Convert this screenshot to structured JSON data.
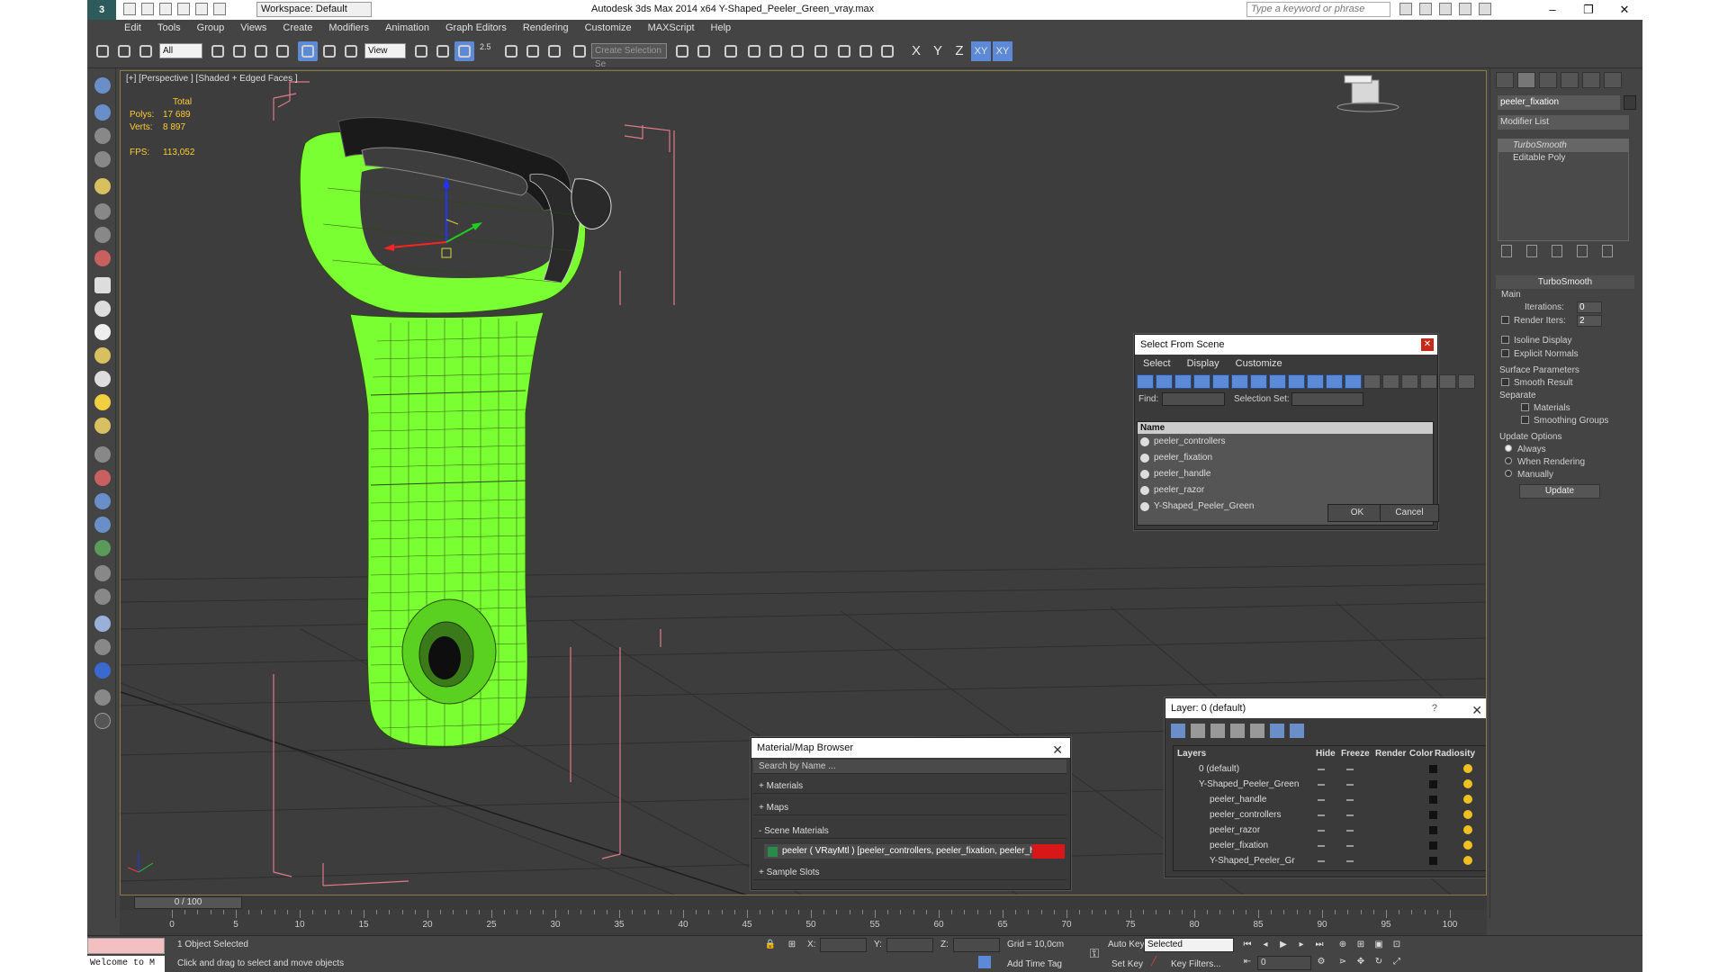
{
  "titlebar": {
    "workspace": "Workspace: Default",
    "app_title": "Autodesk 3ds Max  2014 x64      Y-Shaped_Peeler_Green_vray.max",
    "search_placeholder": "Type a keyword or phrase"
  },
  "menu": [
    "Edit",
    "Tools",
    "Group",
    "Views",
    "Create",
    "Modifiers",
    "Animation",
    "Graph Editors",
    "Rendering",
    "Customize",
    "MAXScript",
    "Help"
  ],
  "toolbar": {
    "selection_filter": "All",
    "ref_coord": "View",
    "snap_value": "2.5",
    "named_selection_placeholder": "Create Selection Se",
    "axis": [
      "X",
      "Y",
      "Z",
      "XY",
      "XY"
    ]
  },
  "viewport": {
    "label": "[+] [Perspective ] [Shaded + Edged Faces ]",
    "stats": {
      "header": "Total",
      "polys_label": "Polys:",
      "polys": "17 689",
      "verts_label": "Verts:",
      "verts": "8 897",
      "fps_label": "FPS:",
      "fps": "113,052"
    }
  },
  "command_panel": {
    "object_name": "peeler_fixation",
    "modifier_list": "Modifier List",
    "stack": [
      "TurboSmooth",
      "Editable Poly"
    ],
    "rollout_title": "TurboSmooth",
    "main_label": "Main",
    "iterations_label": "Iterations:",
    "iterations": "0",
    "render_iters_label": "Render Iters:",
    "render_iters": "2",
    "isoline": "Isoline Display",
    "explicit_normals": "Explicit Normals",
    "surface_params": "Surface Parameters",
    "smooth_result": "Smooth Result",
    "separate": "Separate",
    "materials": "Materials",
    "smoothing_groups": "Smoothing Groups",
    "update_options": "Update Options",
    "always": "Always",
    "when_rendering": "When Rendering",
    "manually": "Manually",
    "update_btn": "Update"
  },
  "select_from_scene": {
    "title": "Select From Scene",
    "menu": [
      "Select",
      "Display",
      "Customize"
    ],
    "find_label": "Find:",
    "selection_set_label": "Selection Set:",
    "name_header": "Name",
    "items": [
      "peeler_controllers",
      "peeler_fixation",
      "peeler_handle",
      "peeler_razor",
      "Y-Shaped_Peeler_Green"
    ],
    "ok": "OK",
    "cancel": "Cancel"
  },
  "material_browser": {
    "title": "Material/Map Browser",
    "search_placeholder": "Search by Name ...",
    "sections": [
      "+ Materials",
      "+ Maps",
      "- Scene Materials",
      "+ Sample Slots"
    ],
    "scene_material": "peeler  ( VRayMtl )  [peeler_controllers, peeler_fixation, peeler_h..."
  },
  "layer_dialog": {
    "title": "Layer: 0 (default)",
    "help": "?",
    "columns": [
      "Layers",
      "Hide",
      "Freeze",
      "Render",
      "Color",
      "Radiosity"
    ],
    "rows": [
      "0 (default)",
      "Y-Shaped_Peeler_Green",
      "peeler_handle",
      "peeler_controllers",
      "peeler_razor",
      "peeler_fixation",
      "Y-Shaped_Peeler_Gr"
    ]
  },
  "timeline": {
    "frame": "0 / 100",
    "ticks": [
      "0",
      "5",
      "10",
      "15",
      "20",
      "25",
      "30",
      "35",
      "40",
      "45",
      "50",
      "55",
      "60",
      "65",
      "70",
      "75",
      "80",
      "85",
      "90",
      "95",
      "100"
    ]
  },
  "status": {
    "selected": "1 Object Selected",
    "prompt": "Click and drag to select and move objects",
    "maxscript": "Welcome to M",
    "x_label": "X:",
    "y_label": "Y:",
    "z_label": "Z:",
    "grid": "Grid = 10,0cm",
    "add_time_tag": "Add Time Tag",
    "auto_key": "Auto Key",
    "set_key": "Set Key",
    "selected_dd": "Selected",
    "key_filters": "Key Filters...",
    "frame_value": "0"
  },
  "colors": {
    "accent": "#5d8ad6",
    "mesh_green": "#7aff32",
    "bbox_pink": "#e07a8a"
  }
}
